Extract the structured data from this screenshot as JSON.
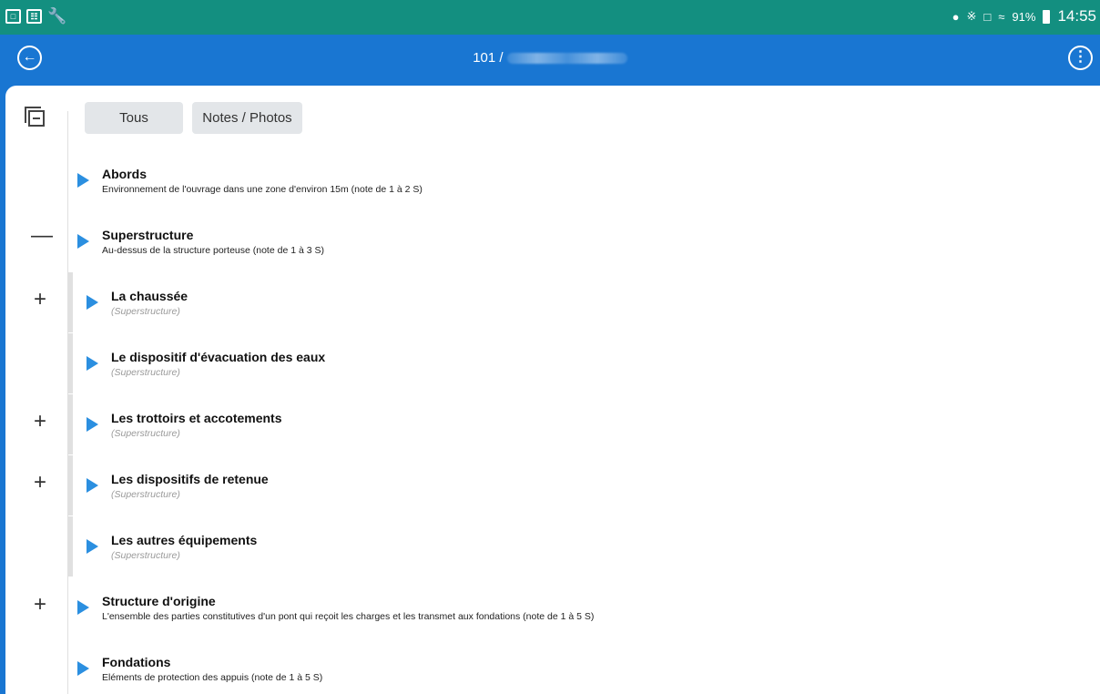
{
  "status_bar": {
    "time": "14:55",
    "battery": "91%"
  },
  "app_bar": {
    "title_prefix": "101 /",
    "back_icon": "arrow-left-icon",
    "menu_icon": "more-vert-icon"
  },
  "filters": {
    "all_label": "Tous",
    "notes_label": "Notes / Photos"
  },
  "sections": [
    {
      "label": "Abords",
      "subtitle": "Environnement de l'ouvrage dans une zone d'environ 15m (note de 1 à 2 S)",
      "expand_symbol": "",
      "child": false
    },
    {
      "label": "Superstructure",
      "subtitle": "Au-dessus de la structure porteuse (note de 1 à 3 S)",
      "expand_symbol": "—",
      "child": false
    },
    {
      "label": "La chaussée",
      "subtitle": "(Superstructure)",
      "expand_symbol": "+",
      "child": true
    },
    {
      "label": "Le dispositif d'évacuation des eaux",
      "subtitle": "(Superstructure)",
      "expand_symbol": "",
      "child": true
    },
    {
      "label": "Les trottoirs et accotements",
      "subtitle": "(Superstructure)",
      "expand_symbol": "+",
      "child": true
    },
    {
      "label": "Les dispositifs de retenue",
      "subtitle": "(Superstructure)",
      "expand_symbol": "+",
      "child": true
    },
    {
      "label": "Les autres équipements",
      "subtitle": "(Superstructure)",
      "expand_symbol": "",
      "child": true
    },
    {
      "label": "Structure d'origine",
      "subtitle": "L'ensemble des parties constitutives d'un pont qui reçoit les charges et les transmet aux fondations (note de 1 à 5 S)",
      "expand_symbol": "+",
      "child": false
    },
    {
      "label": "Fondations",
      "subtitle": "Eléments de protection des appuis (note de 1 à 5 S)",
      "expand_symbol": "",
      "child": false
    }
  ]
}
